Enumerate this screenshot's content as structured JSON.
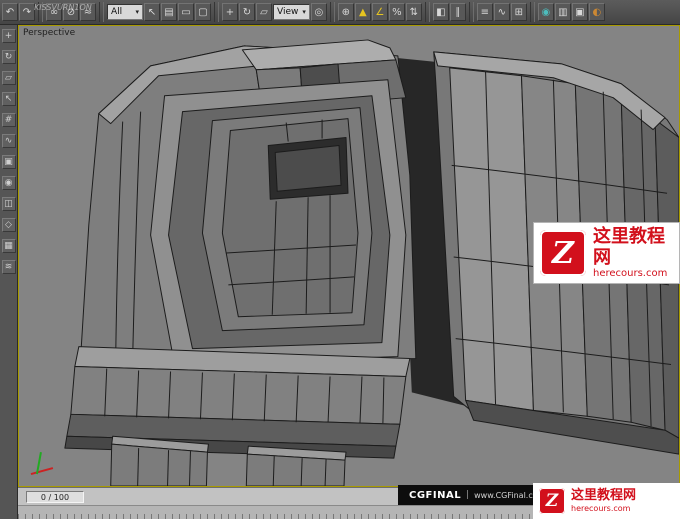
{
  "colors": {
    "viewport_background": "#848484",
    "active_viewport_border": "#a89a00",
    "wireframe": "#1c1c1c",
    "logo_red": "#d2101c",
    "toolbar_background": "#4e4e4e"
  },
  "toolbar": {
    "watermark_text": "KISSVURN1ON",
    "items": [
      {
        "type": "icon",
        "name": "undo-icon",
        "glyph": "↶"
      },
      {
        "type": "icon",
        "name": "redo-icon",
        "glyph": "↷"
      },
      {
        "type": "sep"
      },
      {
        "type": "icon",
        "name": "select-and-link-icon",
        "glyph": "∞"
      },
      {
        "type": "icon",
        "name": "unlink-selection-icon",
        "glyph": "⊘"
      },
      {
        "type": "icon",
        "name": "bind-to-space-warp-icon",
        "glyph": "≈"
      },
      {
        "type": "sep"
      },
      {
        "type": "dropdown",
        "name": "selection-filter-dropdown",
        "label": "All"
      },
      {
        "type": "icon",
        "name": "select-object-icon",
        "glyph": "↖"
      },
      {
        "type": "icon",
        "name": "select-by-name-icon",
        "glyph": "▤"
      },
      {
        "type": "icon",
        "name": "rectangular-selection-icon",
        "glyph": "▭"
      },
      {
        "type": "icon",
        "name": "window-crossing-icon",
        "glyph": "▢"
      },
      {
        "type": "sep"
      },
      {
        "type": "icon",
        "name": "select-and-move-icon",
        "glyph": "+"
      },
      {
        "type": "icon",
        "name": "select-and-rotate-icon",
        "glyph": "↻"
      },
      {
        "type": "icon",
        "name": "select-and-scale-icon",
        "glyph": "▱"
      },
      {
        "type": "dropdown",
        "name": "reference-coordinate-dropdown",
        "label": "View"
      },
      {
        "type": "icon",
        "name": "use-pivot-center-icon",
        "glyph": "◎"
      },
      {
        "type": "sep"
      },
      {
        "type": "icon",
        "name": "select-and-manipulate-icon",
        "glyph": "⊕"
      },
      {
        "type": "icon",
        "name": "snap-toggle-icon",
        "glyph": "▲",
        "color": "#e7c520"
      },
      {
        "type": "icon",
        "name": "angle-snap-icon",
        "glyph": "∠",
        "color": "#e7c520"
      },
      {
        "type": "icon",
        "name": "percent-snap-icon",
        "glyph": "%"
      },
      {
        "type": "icon",
        "name": "spinner-snap-icon",
        "glyph": "⇅"
      },
      {
        "type": "sep"
      },
      {
        "type": "icon",
        "name": "mirror-icon",
        "glyph": "◧"
      },
      {
        "type": "icon",
        "name": "align-icon",
        "glyph": "∥"
      },
      {
        "type": "sep"
      },
      {
        "type": "icon",
        "name": "layer-manager-icon",
        "glyph": "≡"
      },
      {
        "type": "icon",
        "name": "curve-editor-icon",
        "glyph": "∿"
      },
      {
        "type": "icon",
        "name": "schematic-view-icon",
        "glyph": "⊞"
      },
      {
        "type": "sep"
      },
      {
        "type": "icon",
        "name": "material-editor-icon",
        "glyph": "◉",
        "color": "#4dbdbd"
      },
      {
        "type": "icon",
        "name": "named-selection-icon",
        "glyph": "▥"
      },
      {
        "type": "icon",
        "name": "render-setup-icon",
        "glyph": "▣"
      },
      {
        "type": "icon",
        "name": "quick-render-icon",
        "glyph": "◐",
        "color": "#cc8833"
      }
    ]
  },
  "left_toolbar": {
    "items": [
      {
        "name": "left-tool-move-icon",
        "glyph": "+"
      },
      {
        "name": "left-tool-rotate-icon",
        "glyph": "↻"
      },
      {
        "name": "left-tool-scale-icon",
        "glyph": "▱"
      },
      {
        "name": "left-tool-select-icon",
        "glyph": "↖"
      },
      {
        "name": "left-tool-grid-icon",
        "glyph": "#"
      },
      {
        "name": "left-tool-curve-icon",
        "glyph": "∿"
      },
      {
        "name": "left-tool-box-icon",
        "glyph": "▣"
      },
      {
        "name": "left-tool-sphere-icon",
        "glyph": "◉"
      },
      {
        "name": "left-tool-cylinder-icon",
        "glyph": "◫"
      },
      {
        "name": "left-tool-poly-icon",
        "glyph": "◇"
      },
      {
        "name": "left-tool-mesh-icon",
        "glyph": "▦"
      },
      {
        "name": "left-tool-wave-icon",
        "glyph": "≋"
      }
    ]
  },
  "viewport": {
    "label": "Perspective"
  },
  "status_bar": {
    "frame_display": "0 / 100"
  },
  "watermarks": {
    "cgfinal": {
      "brand": "CGFINAL",
      "separator": "|",
      "url": "www.CGFinal.c"
    },
    "site_logo": {
      "badge": "Z",
      "title": "这里教程网",
      "subtitle": "herecours.com"
    }
  }
}
